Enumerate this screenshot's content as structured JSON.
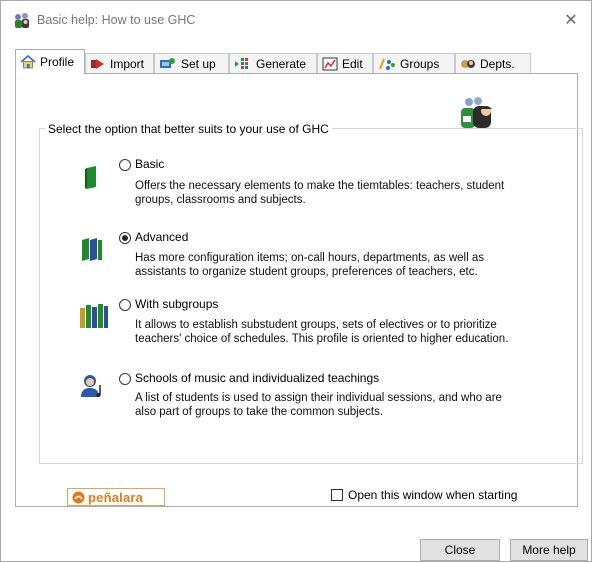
{
  "window": {
    "title": "Basic help: How to use GHC",
    "close_glyph": "✕"
  },
  "tabs": [
    {
      "label": "Profile",
      "icon": "home-icon",
      "active": true
    },
    {
      "label": "Import",
      "icon": "import-arrow-icon"
    },
    {
      "label": "Set up",
      "icon": "setup-icon"
    },
    {
      "label": "Generate",
      "icon": "generate-grid-icon"
    },
    {
      "label": "Edit",
      "icon": "edit-chart-icon"
    },
    {
      "label": "Groups",
      "icon": "groups-icon"
    },
    {
      "label": "Depts.",
      "icon": "departments-icon"
    }
  ],
  "group_label": "Select the option that better suits to your use of GHC",
  "options": [
    {
      "label": "Basic",
      "selected": false,
      "icon": "single-book-icon",
      "description": "Offers the necessary elements to make the tiemtables: teachers, student groups, classrooms and subjects."
    },
    {
      "label": "Advanced",
      "selected": true,
      "icon": "two-books-icon",
      "description": "Has more configuration items; on-call hours, departments, as well as assistants to organize student groups, preferences of teachers, etc."
    },
    {
      "label": "With subgroups",
      "selected": false,
      "icon": "many-books-icon",
      "description": "It allows to establish substudent groups, sets of electives or to prioritize teachers' choice of schedules. This profile is oriented to higher education."
    },
    {
      "label": "Schools of music and individualized teachings",
      "selected": false,
      "icon": "music-teacher-icon",
      "description": "A list of students is used to assign their individual sessions, and who are also part of groups to take the common subjects."
    }
  ],
  "logo_text": "peñalara",
  "open_on_start": {
    "label": "Open this window when starting",
    "checked": false
  },
  "buttons": {
    "close": "Close",
    "more_help": "More help"
  },
  "colors": {
    "accent_orange": "#e07b1f",
    "book_green": "#1f8a2e",
    "book_blue": "#2b4f9a"
  }
}
